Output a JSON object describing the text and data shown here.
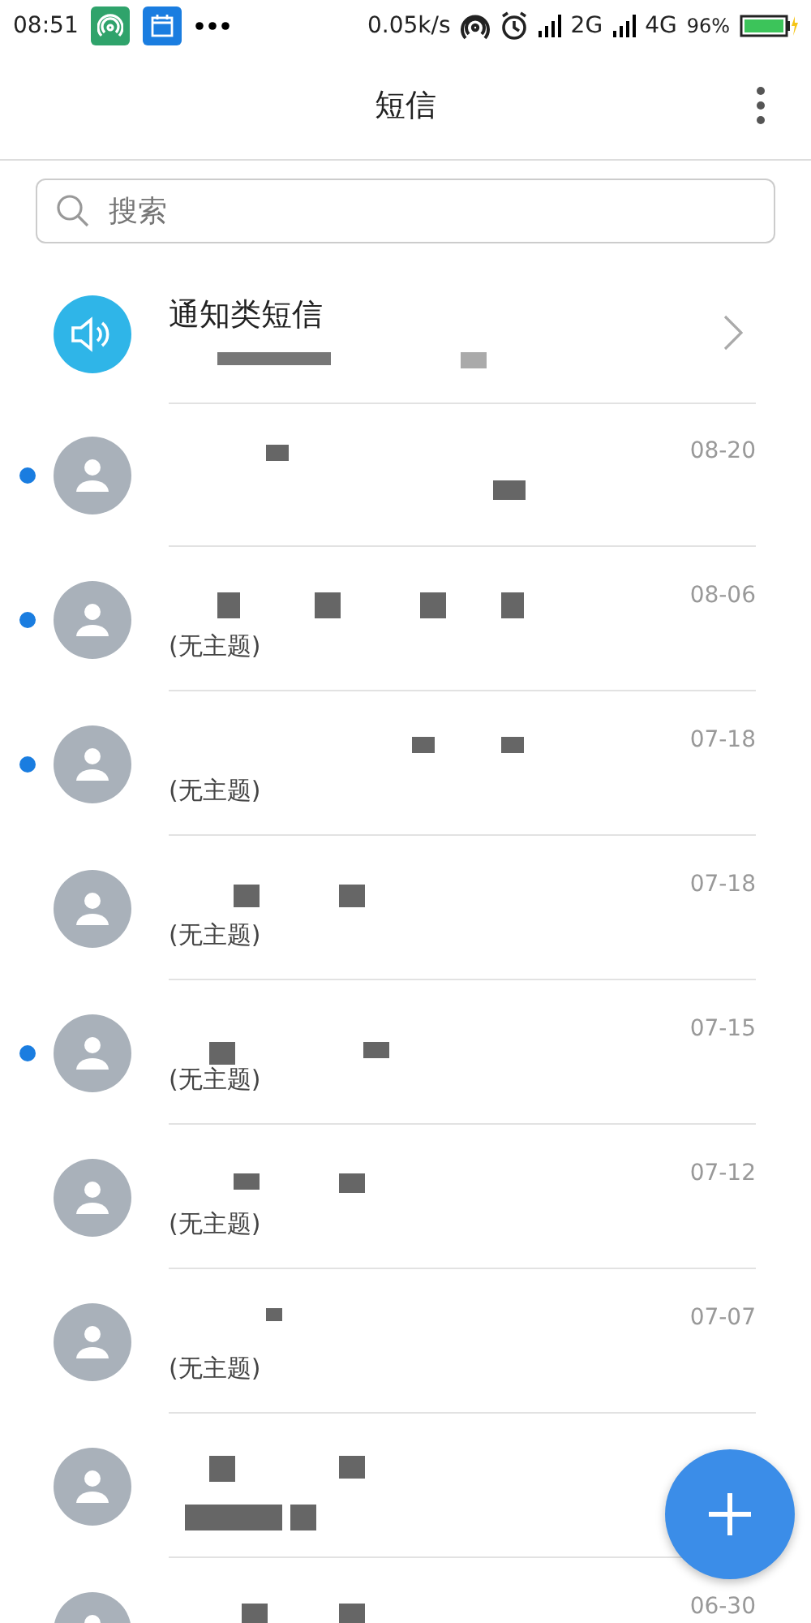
{
  "status_bar": {
    "time": "08:51",
    "speed": "0.05k/s",
    "network_1": "2G",
    "network_2": "4G",
    "battery": "96%"
  },
  "header": {
    "title": "短信"
  },
  "search": {
    "placeholder": "搜索"
  },
  "notification_group": {
    "title": "通知类短信"
  },
  "threads": [
    {
      "date": "08-20",
      "unread": true
    },
    {
      "subject": "(无主题)",
      "date": "08-06",
      "unread": true
    },
    {
      "subject": "(无主题)",
      "date": "07-18",
      "unread": true
    },
    {
      "subject": "(无主题)",
      "date": "07-18",
      "unread": false
    },
    {
      "subject": "(无主题)",
      "date": "07-15",
      "unread": true
    },
    {
      "subject": "(无主题)",
      "date": "07-12",
      "unread": false
    },
    {
      "subject": "(无主题)",
      "date": "07-07",
      "unread": false
    },
    {
      "unread": false
    },
    {
      "date": "06-30"
    }
  ]
}
